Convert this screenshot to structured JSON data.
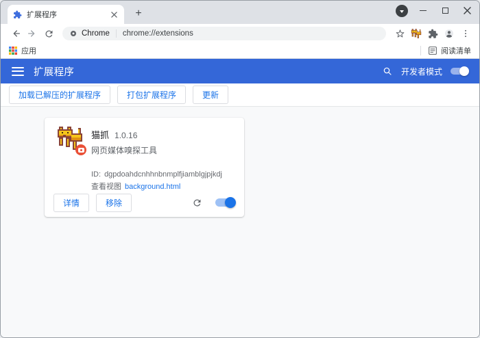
{
  "titlebar": {
    "tab_title": "扩展程序",
    "new_tab_glyph": "+"
  },
  "toolbar": {
    "site_label": "Chrome",
    "url": "chrome://extensions"
  },
  "bookmarks_bar": {
    "apps_label": "应用",
    "reading_list_label": "阅读清单"
  },
  "header": {
    "title": "扩展程序",
    "developer_mode_label": "开发者模式",
    "developer_mode_enabled": true
  },
  "toolbar_actions": {
    "load_unpacked": "加载已解压的扩展程序",
    "pack_extension": "打包扩展程序",
    "update": "更新"
  },
  "extension_card": {
    "name": "猫抓",
    "version": "1.0.16",
    "description": "网页媒体嗅探工具",
    "id_label": "ID:",
    "id_value": "dgpdoahdcnhhnbnmplfjiamblgjpjkdj",
    "views_label": "查看视图",
    "views_link": "background.html",
    "details_button": "详情",
    "remove_button": "移除",
    "enabled": true
  },
  "colors": {
    "header_blue": "#3467d8",
    "accent_blue": "#1a73e8",
    "toggle_track_blue": "#9ec1f5",
    "badge_red": "#ea5037",
    "cat_yellow": "#f6c51b"
  }
}
